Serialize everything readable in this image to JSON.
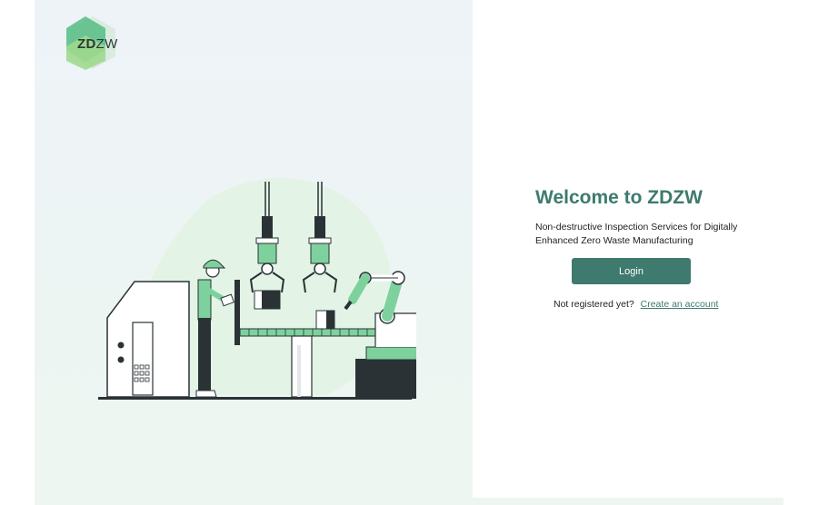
{
  "brand": {
    "logo_text_bold": "ZD",
    "logo_text_light": "ZW",
    "logo_colors": [
      "#5cc08a",
      "#9fd98f",
      "#d9ecdf"
    ]
  },
  "hero": {
    "illustration_icon": "factory-robot-illustration",
    "accent_color": "#7ed19d",
    "dark_color": "#2a3236"
  },
  "welcome": {
    "title": "Welcome to ZDZW",
    "subtitle": "Non-destructive Inspection Services for Digitally Enhanced Zero Waste Manufacturing"
  },
  "actions": {
    "login_label": "Login",
    "register_prompt": "Not registered yet?",
    "register_link": "Create an account"
  },
  "colors": {
    "primary": "#3e7a6e",
    "panel_bg": "#eef3f8"
  }
}
